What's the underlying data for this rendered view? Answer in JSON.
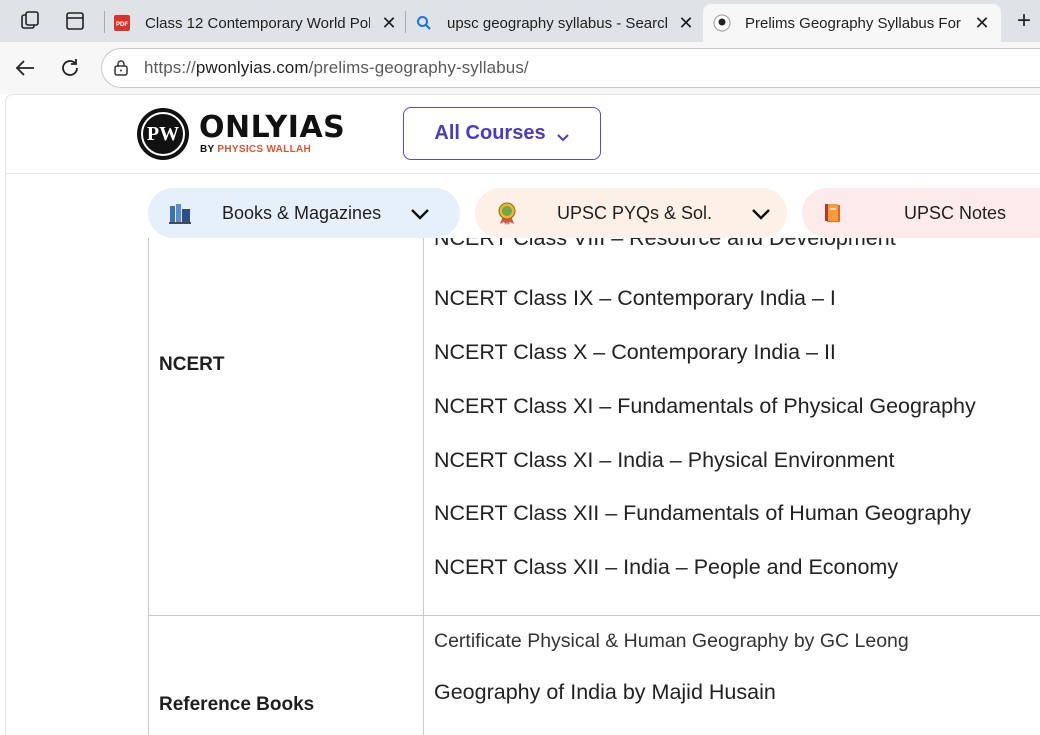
{
  "browser": {
    "tabs": [
      {
        "title": "Class 12 Contemporary World Pol",
        "favicon": "pdf-icon",
        "active": false
      },
      {
        "title": "upsc geography syllabus - Search",
        "favicon": "search-icon",
        "active": false
      },
      {
        "title": "Prelims Geography Syllabus For U",
        "favicon": "pw-favicon",
        "active": true
      }
    ],
    "pdf_badge": "PDF",
    "url_scheme": "https://",
    "url_host": "pwonlyias.com",
    "url_path": "/prelims-geography-syllabus/"
  },
  "site": {
    "logo_letters": "PW",
    "logo_wordmark": "ONLYIAS",
    "logo_sub_prefix": "BY ",
    "logo_sub_accent": "PHYSICS WALLAH",
    "all_courses_label": "All Courses",
    "nav_pills": [
      {
        "label": "Books & Magazines",
        "icon": "books-icon",
        "bg": "#e6f0fb"
      },
      {
        "label": "UPSC PYQs & Sol.",
        "icon": "medal-icon",
        "bg": "#fdf0e6"
      },
      {
        "label": "UPSC Notes",
        "icon": "notebook-icon",
        "bg": "#fdebeb"
      }
    ]
  },
  "table": {
    "rows": [
      {
        "label": "NCERT",
        "items": [
          "NCERT Class VIII – Resource and Development",
          "NCERT Class IX – Contemporary India – I",
          "NCERT Class X – Contemporary India – II",
          "NCERT Class XI – Fundamentals of Physical Geography",
          "NCERT Class XI – India – Physical Environment",
          "NCERT Class XII – Fundamentals of Human Geography",
          "NCERT Class XII – India – People and Economy"
        ]
      },
      {
        "label": "Reference Books",
        "items": [
          "Certificate Physical & Human Geography by GC Leong",
          "Geography of India by Majid Husain"
        ]
      }
    ]
  },
  "colors": {
    "accent": "#4b3bc2",
    "logo_accent": "#e2522f"
  }
}
